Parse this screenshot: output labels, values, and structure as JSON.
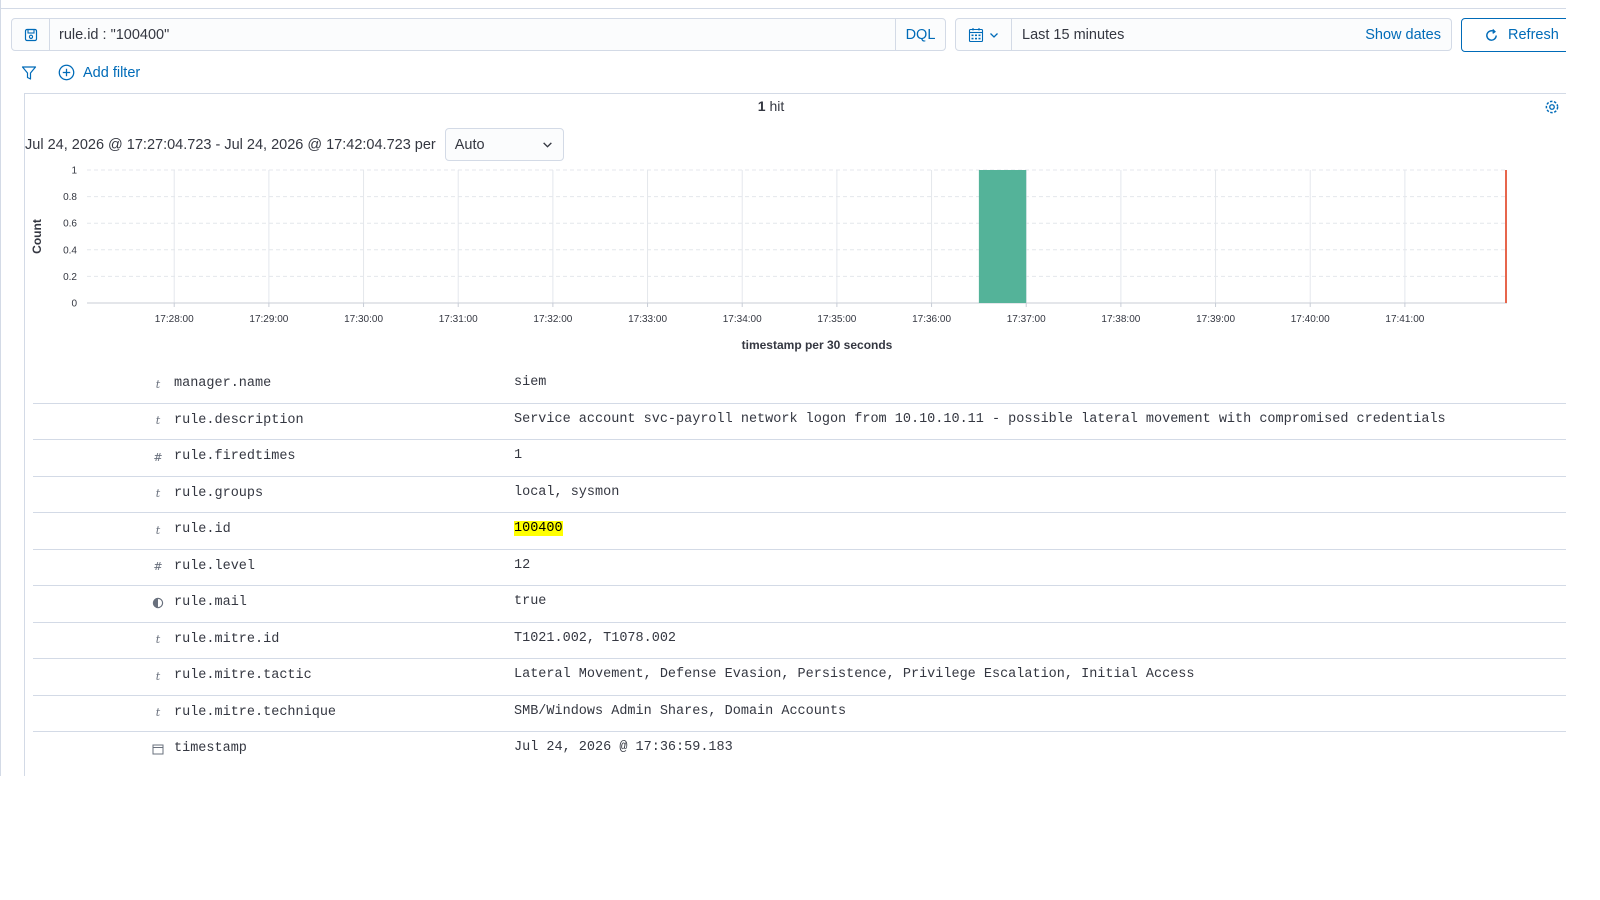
{
  "query": {
    "value": "rule.id : \"100400\"",
    "language_label": "DQL",
    "save_icon": "save-icon"
  },
  "datepicker": {
    "range_label": "Last 15 minutes",
    "show_dates_label": "Show dates",
    "icon": "calendar-icon"
  },
  "refresh": {
    "label": "Refresh",
    "icon": "refresh-icon"
  },
  "filters": {
    "add_filter_label": "Add filter",
    "icon": "filter-icon"
  },
  "results": {
    "hit_count": "1",
    "hit_word": "hit",
    "time_range_text": "Jul 24, 2026 @ 17:27:04.723 - Jul 24, 2026 @ 17:42:04.723 per",
    "interval_selected": "Auto"
  },
  "chart_data": {
    "type": "bar",
    "xlabel": "timestamp per 30 seconds",
    "ylabel": "Count",
    "x_ticks": [
      "17:28:00",
      "17:29:00",
      "17:30:00",
      "17:31:00",
      "17:32:00",
      "17:33:00",
      "17:34:00",
      "17:35:00",
      "17:36:00",
      "17:37:00",
      "17:38:00",
      "17:39:00",
      "17:40:00",
      "17:41:00"
    ],
    "y_ticks": [
      "0",
      "0.2",
      "0.4",
      "0.6",
      "0.8",
      "1"
    ],
    "ylim": [
      0,
      1
    ],
    "xlim": [
      "17:27:04.723",
      "17:42:04.723"
    ],
    "bars": [
      {
        "start": "17:36:30",
        "end": "17:37:00",
        "value": 1
      }
    ],
    "bar_color": "#54b399",
    "now_marker_color": "#e7664c",
    "grid": true
  },
  "document": {
    "fields": [
      {
        "type_icon": "t",
        "name": "manager.name",
        "value": "siem"
      },
      {
        "type_icon": "t",
        "name": "rule.description",
        "value": "Service account svc-payroll network logon from 10.10.10.11 - possible lateral movement with compromised credentials"
      },
      {
        "type_icon": "#",
        "name": "rule.firedtimes",
        "value": "1"
      },
      {
        "type_icon": "t",
        "name": "rule.groups",
        "value": "local, sysmon"
      },
      {
        "type_icon": "t",
        "name": "rule.id",
        "value": "100400",
        "highlight": true
      },
      {
        "type_icon": "#",
        "name": "rule.level",
        "value": "12"
      },
      {
        "type_icon": "boolean",
        "name": "rule.mail",
        "value": "true"
      },
      {
        "type_icon": "t",
        "name": "rule.mitre.id",
        "value": "T1021.002, T1078.002"
      },
      {
        "type_icon": "t",
        "name": "rule.mitre.tactic",
        "value": "Lateral Movement, Defense Evasion, Persistence, Privilege Escalation, Initial Access"
      },
      {
        "type_icon": "t",
        "name": "rule.mitre.technique",
        "value": "SMB/Windows Admin Shares, Domain Accounts"
      },
      {
        "type_icon": "date",
        "name": "timestamp",
        "value": "Jul 24, 2026 @ 17:36:59.183"
      }
    ]
  }
}
